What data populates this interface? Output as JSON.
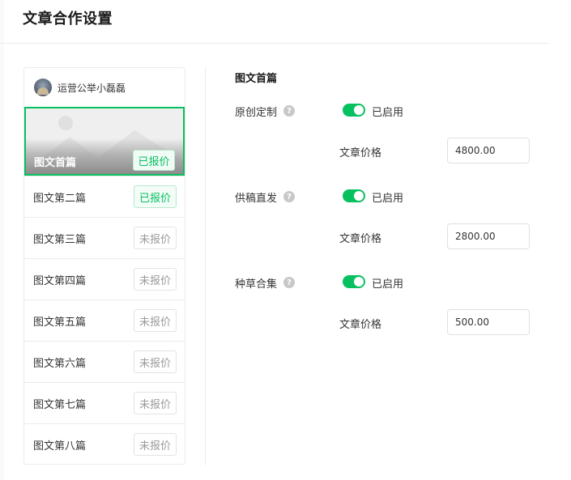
{
  "page": {
    "title": "文章合作设置"
  },
  "account": {
    "name": "运营公举小磊磊"
  },
  "articles": [
    {
      "label": "图文首篇",
      "status": "已报价"
    },
    {
      "label": "图文第二篇",
      "status": "已报价"
    },
    {
      "label": "图文第三篇",
      "status": "未报价"
    },
    {
      "label": "图文第四篇",
      "status": "未报价"
    },
    {
      "label": "图文第五篇",
      "status": "未报价"
    },
    {
      "label": "图文第六篇",
      "status": "未报价"
    },
    {
      "label": "图文第七篇",
      "status": "未报价"
    },
    {
      "label": "图文第八篇",
      "status": "未报价"
    }
  ],
  "detail": {
    "title": "图文首篇",
    "help_glyph": "?",
    "settings": [
      {
        "label": "原创定制",
        "enabled": true,
        "status_text": "已启用",
        "price_label": "文章价格",
        "price": "4800.00"
      },
      {
        "label": "供稿直发",
        "enabled": true,
        "status_text": "已启用",
        "price_label": "文章价格",
        "price": "2800.00"
      },
      {
        "label": "种草合集",
        "enabled": true,
        "status_text": "已启用",
        "price_label": "文章价格",
        "price": "500.00"
      }
    ]
  },
  "colors": {
    "accent": "#07c160",
    "border": "#ebebeb",
    "muted": "#9a9a9a"
  },
  "icons": {
    "help": "question-circle-icon",
    "avatar": "account-avatar",
    "cover": "image-placeholder-icon"
  }
}
